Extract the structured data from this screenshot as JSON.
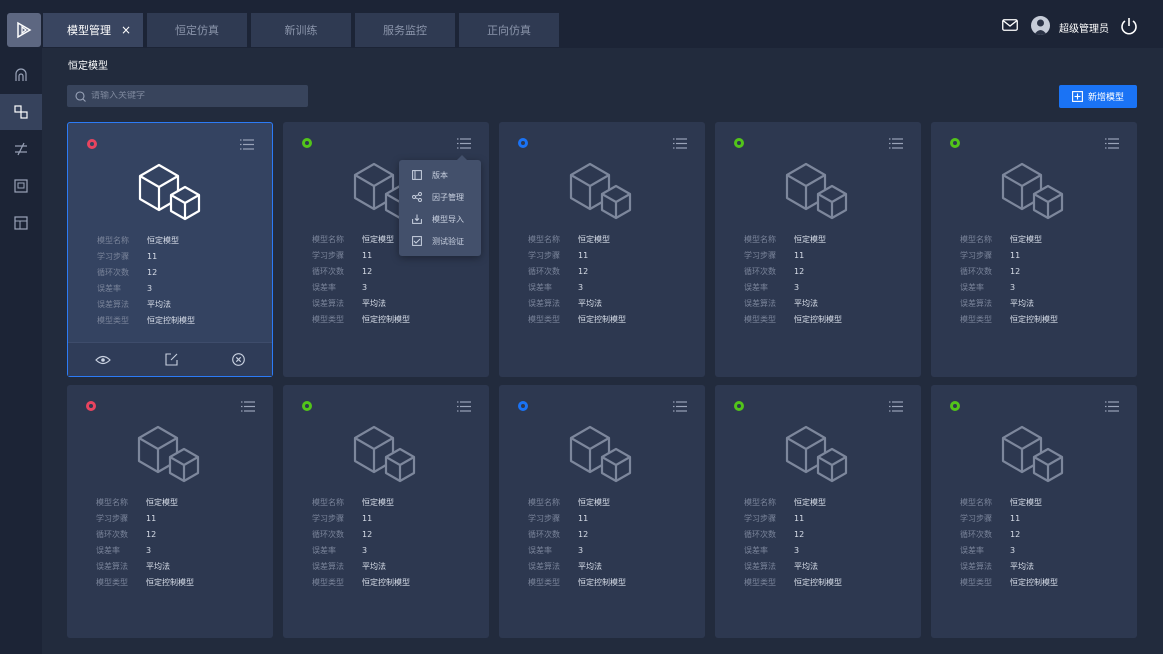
{
  "header": {
    "tabs": [
      {
        "label": "模型管理",
        "active": true
      },
      {
        "label": "恒定仿真",
        "active": false
      },
      {
        "label": "新训练",
        "active": false
      },
      {
        "label": "服务监控",
        "active": false
      },
      {
        "label": "正向仿真",
        "active": false
      }
    ],
    "tab_close": "×",
    "user": "超级管理员"
  },
  "sidebar": {
    "items": [
      {
        "icon": "home-icon"
      },
      {
        "icon": "model-icon",
        "active": true
      },
      {
        "icon": "compare-icon"
      },
      {
        "icon": "image-icon"
      },
      {
        "icon": "book-icon"
      }
    ]
  },
  "page": {
    "title": "恒定模型",
    "search_placeholder": "请输入关键字",
    "add_label": "新增模型"
  },
  "field_labels": [
    "模型名称",
    "学习步骤",
    "循环次数",
    "误差率",
    "误差算法",
    "模型类型"
  ],
  "cards": [
    {
      "status": "#e8445f",
      "values": [
        "恒定模型",
        "11",
        "12",
        "3",
        "平均法",
        "恒定控制模型"
      ]
    },
    {
      "status": "#52c41a",
      "values": [
        "恒定模型",
        "11",
        "12",
        "3",
        "平均法",
        "恒定控制模型"
      ]
    },
    {
      "status": "#1a73f5",
      "values": [
        "恒定模型",
        "11",
        "12",
        "3",
        "平均法",
        "恒定控制模型"
      ]
    },
    {
      "status": "#52c41a",
      "values": [
        "恒定模型",
        "11",
        "12",
        "3",
        "平均法",
        "恒定控制模型"
      ]
    },
    {
      "status": "#52c41a",
      "values": [
        "恒定模型",
        "11",
        "12",
        "3",
        "平均法",
        "恒定控制模型"
      ]
    },
    {
      "status": "#e8445f",
      "values": [
        "恒定模型",
        "11",
        "12",
        "3",
        "平均法",
        "恒定控制模型"
      ]
    },
    {
      "status": "#52c41a",
      "values": [
        "恒定模型",
        "11",
        "12",
        "3",
        "平均法",
        "恒定控制模型"
      ]
    },
    {
      "status": "#1a73f5",
      "values": [
        "恒定模型",
        "11",
        "12",
        "3",
        "平均法",
        "恒定控制模型"
      ]
    },
    {
      "status": "#52c41a",
      "values": [
        "恒定模型",
        "11",
        "12",
        "3",
        "平均法",
        "恒定控制模型"
      ]
    },
    {
      "status": "#52c41a",
      "values": [
        "恒定模型",
        "11",
        "12",
        "3",
        "平均法",
        "恒定控制模型"
      ]
    }
  ],
  "dropdown": {
    "items": [
      {
        "label": "版本",
        "icon": "version-icon"
      },
      {
        "label": "因子管理",
        "icon": "share-icon"
      },
      {
        "label": "模型导入",
        "icon": "import-icon"
      },
      {
        "label": "测试验证",
        "icon": "test-icon"
      }
    ]
  }
}
